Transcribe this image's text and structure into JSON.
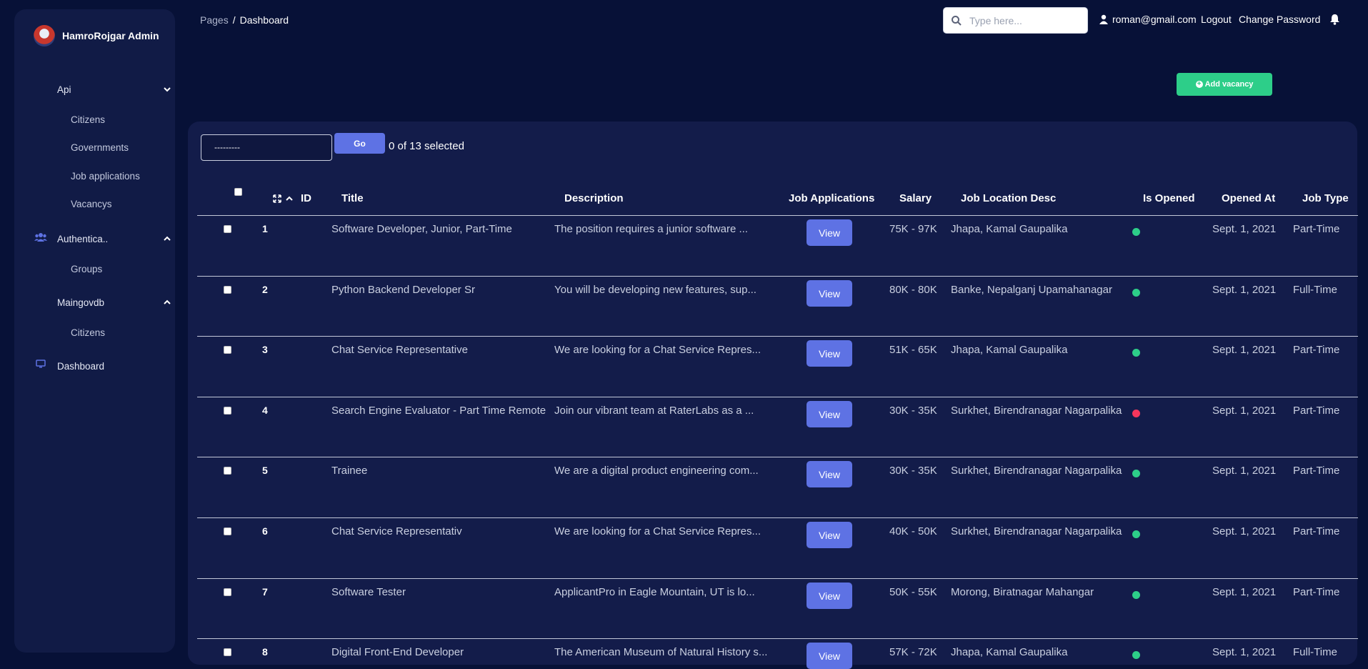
{
  "sidebar": {
    "brand": "HamroRojgar Admin",
    "groups": [
      {
        "label": "Api",
        "items": [
          "Citizens",
          "Governments",
          "Job applications",
          "Vacancys"
        ]
      },
      {
        "label": "Authentica..",
        "items": [
          "Groups"
        ]
      },
      {
        "label": "Maingovdb",
        "items": [
          "Citizens"
        ]
      }
    ],
    "dashboard": "Dashboard"
  },
  "header": {
    "breadcrumb_root": "Pages",
    "breadcrumb_sep": "/",
    "breadcrumb_current": "Dashboard",
    "search_placeholder": "Type here...",
    "user_email": "roman@gmail.com",
    "logout": "Logout",
    "change_password": "Change Password"
  },
  "toolbar": {
    "add_vacancy": "Add vacancy",
    "action_value": "---------",
    "go": "Go",
    "selection": "0 of 13 selected"
  },
  "table": {
    "columns": [
      "ID",
      "Title",
      "Description",
      "Job Applications",
      "Salary",
      "Job Location Desc",
      "Is Opened",
      "Opened At",
      "Job Type"
    ],
    "view_label": "View",
    "rows": [
      {
        "id": "1",
        "title": "Software Developer, Junior, Part-Time",
        "description": "The position requires a junior software ...",
        "salary": "75K - 97K",
        "location": "Jhapa, Kamal Gaupalika",
        "opened": true,
        "opened_at": "Sept. 1, 2021",
        "job_type": "Part-Time"
      },
      {
        "id": "2",
        "title": "Python Backend Developer Sr",
        "description": "You will be developing new features, sup...",
        "salary": "80K - 80K",
        "location": "Banke, Nepalganj Upamahanagar",
        "opened": true,
        "opened_at": "Sept. 1, 2021",
        "job_type": "Full-Time"
      },
      {
        "id": "3",
        "title": "Chat Service Representative",
        "description": "We are looking for a Chat Service Repres...",
        "salary": "51K - 65K",
        "location": "Jhapa, Kamal Gaupalika",
        "opened": true,
        "opened_at": "Sept. 1, 2021",
        "job_type": "Part-Time"
      },
      {
        "id": "4",
        "title": "Search Engine Evaluator - Part Time Remote",
        "description": "Join our vibrant team at RaterLabs as a ...",
        "salary": "30K - 35K",
        "location": "Surkhet, Birendranagar Nagarpalika",
        "opened": false,
        "opened_at": "Sept. 1, 2021",
        "job_type": "Part-Time"
      },
      {
        "id": "5",
        "title": "Trainee",
        "description": "We are a digital product engineering com...",
        "salary": "30K - 35K",
        "location": "Surkhet, Birendranagar Nagarpalika",
        "opened": true,
        "opened_at": "Sept. 1, 2021",
        "job_type": "Part-Time"
      },
      {
        "id": "6",
        "title": "Chat Service Representativ",
        "description": "We are looking for a Chat Service Repres...",
        "salary": "40K - 50K",
        "location": "Surkhet, Birendranagar Nagarpalika",
        "opened": true,
        "opened_at": "Sept. 1, 2021",
        "job_type": "Part-Time"
      },
      {
        "id": "7",
        "title": "Software Tester",
        "description": "ApplicantPro in Eagle Mountain, UT is lo...",
        "salary": "50K - 55K",
        "location": "Morong, Biratnagar Mahangar",
        "opened": true,
        "opened_at": "Sept. 1, 2021",
        "job_type": "Part-Time"
      },
      {
        "id": "8",
        "title": "Digital Front-End Developer",
        "description": "The American Museum of Natural History s...",
        "salary": "57K - 72K",
        "location": "Jhapa, Kamal Gaupalika",
        "opened": true,
        "opened_at": "Sept. 1, 2021",
        "job_type": "Full-Time"
      }
    ]
  },
  "colors": {
    "background": "#071137",
    "panel": "#131c4a",
    "primary": "#5e72e4",
    "success": "#2dce89",
    "danger": "#f5365c"
  }
}
